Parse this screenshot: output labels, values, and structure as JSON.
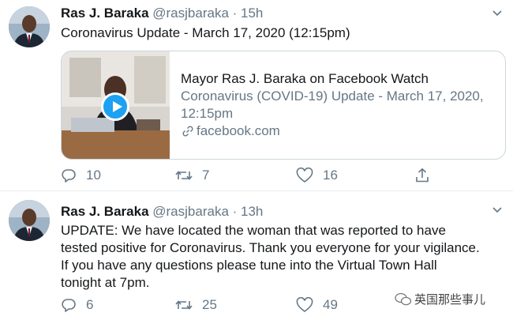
{
  "tweets": [
    {
      "name": "Ras J. Baraka",
      "handle": "@rasjbaraka",
      "time": "15h",
      "text": "Coronavirus Update - March 17, 2020 (12:15pm)",
      "card": {
        "title": "Mayor Ras J. Baraka on Facebook Watch",
        "description": "Coronavirus (COVID-19) Update - March 17, 2020, 12:15pm",
        "domain": "facebook.com"
      },
      "stats": {
        "replies": "10",
        "retweets": "7",
        "likes": "16"
      }
    },
    {
      "name": "Ras J. Baraka",
      "handle": "@rasjbaraka",
      "time": "13h",
      "lines": [
        "UPDATE: We have located the woman that was reported to have",
        "tested positive for Coronavirus. Thank you everyone for your vigilance.",
        "If you have any questions please tune into the Virtual Town Hall",
        "tonight at 7pm."
      ],
      "stats": {
        "replies": "6",
        "retweets": "25",
        "likes": "49"
      }
    }
  ],
  "separator": " · ",
  "watermark": "英国那些事儿",
  "colors": {
    "link_blue": "#1da1f2",
    "secondary": "#657786",
    "border": "#ccd6dd"
  }
}
